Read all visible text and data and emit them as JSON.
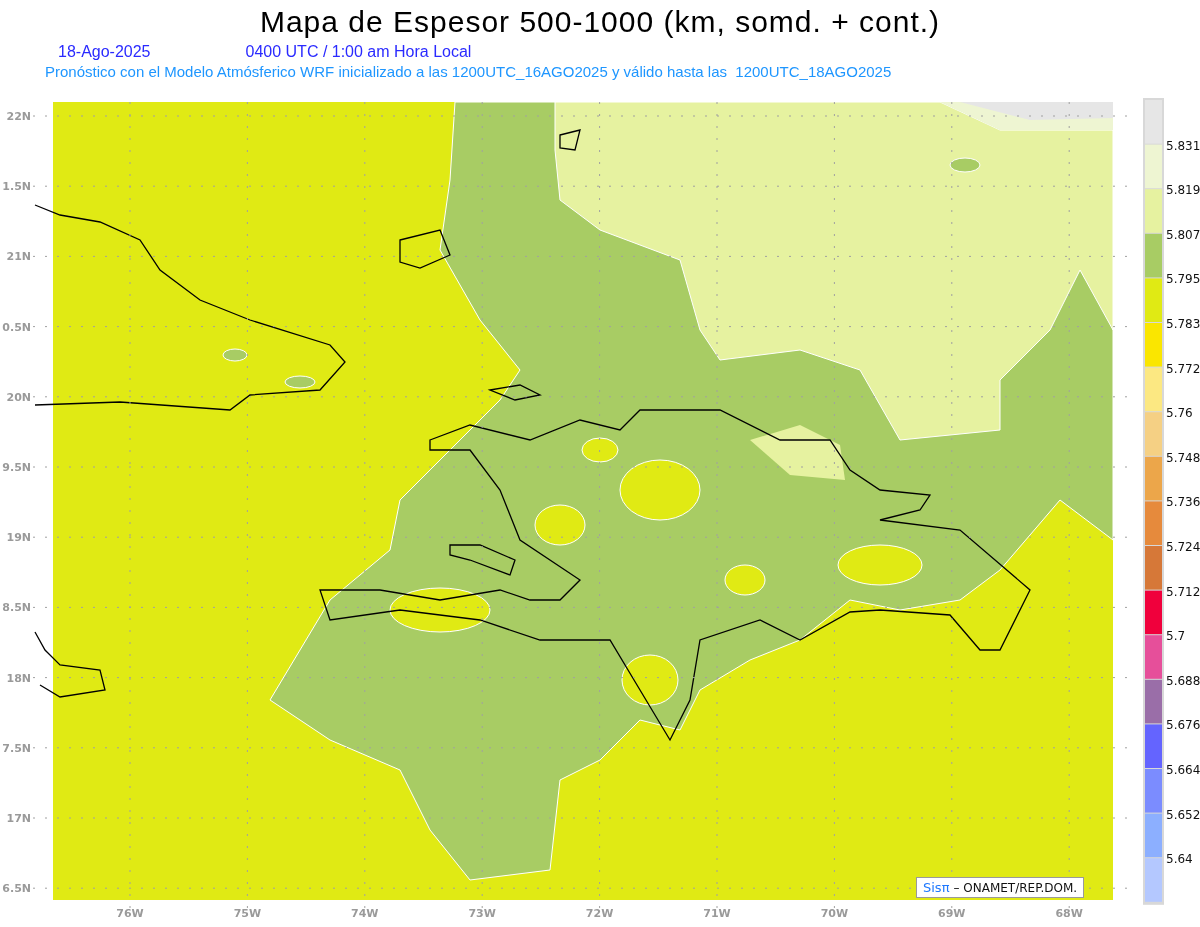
{
  "title": "Mapa de Espesor 500-1000 (km, somd. + cont.)",
  "date": "18-Ago-2025",
  "time": "0400 UTC / 1:00 am Hora Local",
  "subtitle": "Pronóstico con el Modelo Atmósferico WRF inicializado a las 1200UTC_16AGO2025 y válido hasta las  1200UTC_18AGO2025",
  "lat_labels": [
    "22N",
    "1.5N",
    "21N",
    "0.5N",
    "20N",
    "9.5N",
    "19N",
    "8.5N",
    "18N",
    "7.5N",
    "17N",
    "6.5N"
  ],
  "lon_labels": [
    "76W",
    "75W",
    "74W",
    "73W",
    "72W",
    "71W",
    "70W",
    "69W",
    "68W"
  ],
  "legend": [
    {
      "color": "#e6e6e6",
      "label": "5.831"
    },
    {
      "color": "#eef5d2",
      "label": "5.819"
    },
    {
      "color": "#e6f2a0",
      "label": "5.807"
    },
    {
      "color": "#a8cc64",
      "label": "5.795"
    },
    {
      "color": "#e0ea14",
      "label": "5.783"
    },
    {
      "color": "#fae600",
      "label": "5.772"
    },
    {
      "color": "#fce882",
      "label": "5.76"
    },
    {
      "color": "#f5d084",
      "label": "5.748"
    },
    {
      "color": "#eca64a",
      "label": "5.736"
    },
    {
      "color": "#e68a3c",
      "label": "5.724"
    },
    {
      "color": "#d67838",
      "label": "5.712"
    },
    {
      "color": "#f0003c",
      "label": "5.7"
    },
    {
      "color": "#e64f9a",
      "label": "5.688"
    },
    {
      "color": "#9a6ea8",
      "label": "5.676"
    },
    {
      "color": "#6464ff",
      "label": "5.664"
    },
    {
      "color": "#7b8cff",
      "label": "5.652"
    },
    {
      "color": "#8cafff",
      "label": "5.64"
    },
    {
      "color": "#b4c8ff"
    }
  ],
  "attribution": {
    "logo": "Sisπ",
    "text": "– ONAMET/REP.DOM."
  }
}
